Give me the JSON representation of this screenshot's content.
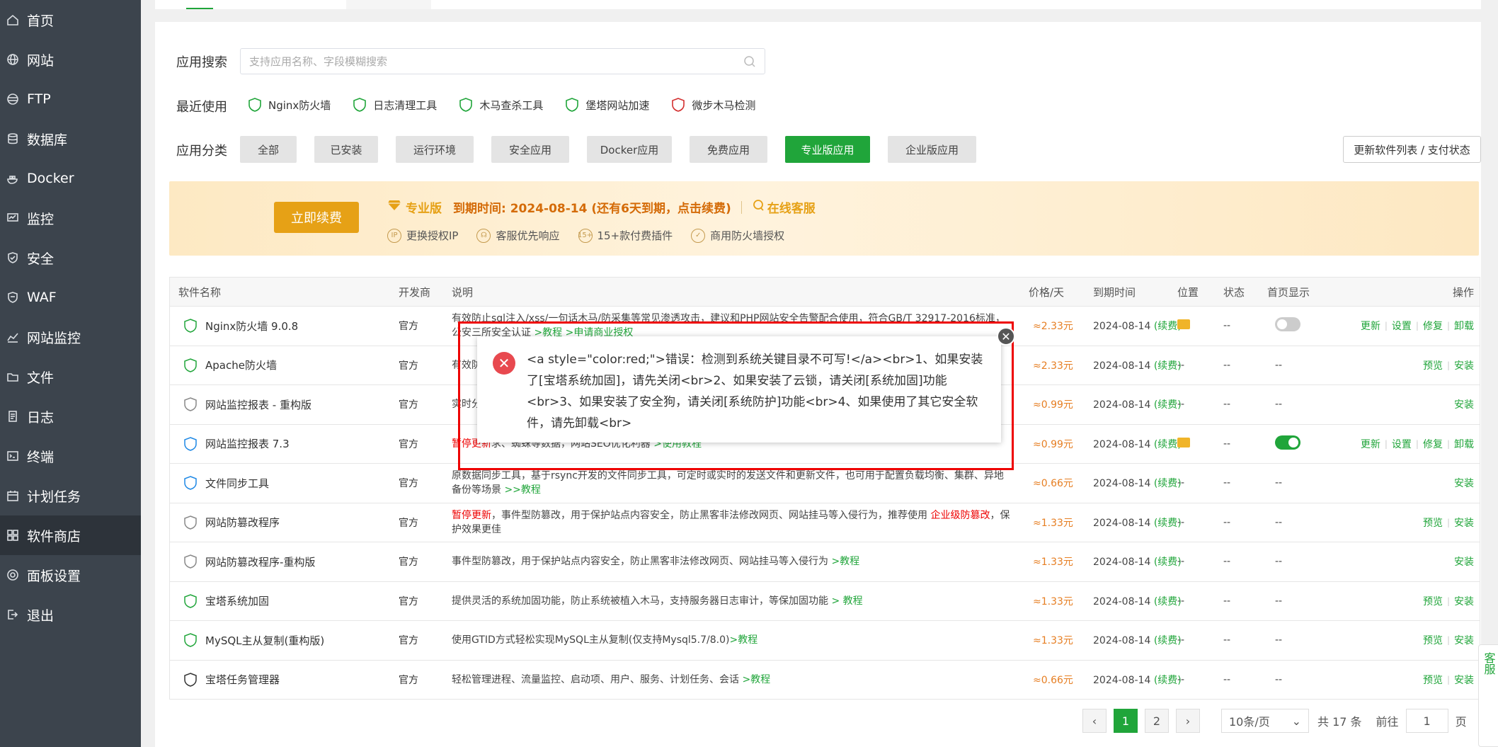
{
  "sidebar": {
    "items": [
      {
        "label": "首页",
        "icon": "home-icon"
      },
      {
        "label": "网站",
        "icon": "globe-icon"
      },
      {
        "label": "FTP",
        "icon": "ftp-icon"
      },
      {
        "label": "数据库",
        "icon": "database-icon"
      },
      {
        "label": "Docker",
        "icon": "docker-icon"
      },
      {
        "label": "监控",
        "icon": "monitor-icon"
      },
      {
        "label": "安全",
        "icon": "shield-icon"
      },
      {
        "label": "WAF",
        "icon": "waf-icon"
      },
      {
        "label": "网站监控",
        "icon": "chart-icon"
      },
      {
        "label": "文件",
        "icon": "folder-icon"
      },
      {
        "label": "日志",
        "icon": "log-icon"
      },
      {
        "label": "终端",
        "icon": "terminal-icon"
      },
      {
        "label": "计划任务",
        "icon": "calendar-icon"
      },
      {
        "label": "软件商店",
        "icon": "grid-icon"
      },
      {
        "label": "面板设置",
        "icon": "gear-icon"
      },
      {
        "label": "退出",
        "icon": "logout-icon"
      }
    ],
    "active_index": 13
  },
  "search": {
    "label": "应用搜索",
    "placeholder": "支持应用名称、字段模糊搜索"
  },
  "recent": {
    "label": "最近使用",
    "items": [
      "Nginx防火墙",
      "日志清理工具",
      "木马查杀工具",
      "堡塔网站加速",
      "微步木马检测"
    ]
  },
  "categories": {
    "label": "应用分类",
    "items": [
      "全部",
      "已安装",
      "运行环境",
      "安全应用",
      "Docker应用",
      "免费应用",
      "专业版应用",
      "企业版应用"
    ],
    "active": "专业版应用",
    "refresh": "更新软件列表 / 支付状态"
  },
  "banner": {
    "renew": "立即续费",
    "edition": "专业版",
    "expire": "到期时间: 2024-08-14 (还有6天到期，点击续费)",
    "service": "在线客服",
    "perks": [
      "更换授权IP",
      "客服优先响应",
      "15+款付费插件",
      "商用防火墙授权"
    ],
    "perk_badges": [
      "IP",
      "☊",
      "15+",
      "✓"
    ]
  },
  "table": {
    "headers": {
      "name": "软件名称",
      "dev": "开发商",
      "desc": "说明",
      "price": "价格/天",
      "expire": "到期时间",
      "pos": "位置",
      "state": "状态",
      "home": "首页显示",
      "ops": "操作"
    },
    "rows": [
      {
        "name": "Nginx防火墙 9.0.8",
        "dev": "官方",
        "desc_pre": "有效防止sql注入/xss/一句话木马/防采集等常见渗透攻击，建议和PHP网站安全告警配合使用，符合GB/T 32917-2016标准，公安三所安全认证",
        "desc_red": "",
        "desc_link": " >教程  >申请商业授权",
        "price": "≈2.33元",
        "expire": "2024-08-14",
        "renew": "(续费)",
        "pos": "folder",
        "state": "--",
        "home": "off",
        "ops": [
          "更新",
          "设置",
          "修复",
          "卸载"
        ]
      },
      {
        "name": "Apache防火墙",
        "dev": "官方",
        "desc_pre": "有效防",
        "desc_red": "",
        "desc_link": "",
        "price": "≈2.33元",
        "expire": "2024-08-14",
        "renew": "(续费)",
        "pos": "--",
        "state": "--",
        "home": "--",
        "ops": [
          "预览",
          "安装"
        ]
      },
      {
        "name": "网站监控报表 - 重构版",
        "dev": "官方",
        "desc_pre": "实时分析网站运行状态，s当前",
        "desc_red": "",
        "desc_link": "",
        "price": "≈0.99元",
        "expire": "2024-08-14",
        "renew": "(续费)",
        "pos": "--",
        "state": "--",
        "home": "--",
        "ops": [
          "安装"
        ]
      },
      {
        "name": "网站监控报表 7.3",
        "dev": "官方",
        "desc_pre": "",
        "desc_red": "暂停更新",
        "desc_mid": "求、蜘蛛等数据，网站SEO优化利器",
        "desc_link": " >使用教程",
        "price": "≈0.99元",
        "expire": "2024-08-14",
        "renew": "(续费)",
        "pos": "folder",
        "state": "--",
        "home": "on",
        "ops": [
          "更新",
          "设置",
          "修复",
          "卸载"
        ]
      },
      {
        "name": "文件同步工具",
        "dev": "官方",
        "desc_pre": "原数据同步工具，基于rsync开发的文件同步工具，可定时或实时的发送文件和更新文件，也可用于配置负载均衡、集群、异地备份等场景",
        "desc_red": "",
        "desc_link": " >>教程",
        "price": "≈0.66元",
        "expire": "2024-08-14",
        "renew": "(续费)",
        "pos": "--",
        "state": "--",
        "home": "--",
        "ops": [
          "安装"
        ]
      },
      {
        "name": "网站防篡改程序",
        "dev": "官方",
        "desc_pre": "",
        "desc_red": "暂停更新",
        "desc_mid": "，事件型防篡改，用于保护站点内容安全，防止黑客非法修改网页、网站挂马等入侵行为，推荐使用 ",
        "desc_red2": "企业级防篡改",
        "desc_tail": "，保护效果更佳",
        "desc_link": "",
        "price": "≈1.33元",
        "expire": "2024-08-14",
        "renew": "(续费)",
        "pos": "--",
        "state": "--",
        "home": "--",
        "ops": [
          "预览",
          "安装"
        ]
      },
      {
        "name": "网站防篡改程序-重构版",
        "dev": "官方",
        "desc_pre": "事件型防篡改，用于保护站点内容安全，防止黑客非法修改网页、网站挂马等入侵行为",
        "desc_red": "",
        "desc_link": " >教程",
        "price": "≈1.33元",
        "expire": "2024-08-14",
        "renew": "(续费)",
        "pos": "--",
        "state": "--",
        "home": "--",
        "ops": [
          "安装"
        ]
      },
      {
        "name": "宝塔系统加固",
        "dev": "官方",
        "desc_pre": "提供灵活的系统加固功能，防止系统被植入木马，支持服务器日志审计，等保加固功能",
        "desc_red": "",
        "desc_link": " > 教程",
        "price": "≈1.33元",
        "expire": "2024-08-14",
        "renew": "(续费)",
        "pos": "--",
        "state": "--",
        "home": "--",
        "ops": [
          "预览",
          "安装"
        ]
      },
      {
        "name": "MySQL主从复制(重构版)",
        "dev": "官方",
        "desc_pre": "使用GTID方式轻松实现MySQL主从复制(仅支持Mysql5.7/8.0)",
        "desc_red": "",
        "desc_link": ">教程",
        "price": "≈1.33元",
        "expire": "2024-08-14",
        "renew": "(续费)",
        "pos": "--",
        "state": "--",
        "home": "--",
        "ops": [
          "预览",
          "安装"
        ]
      },
      {
        "name": "宝塔任务管理器",
        "dev": "官方",
        "desc_pre": "轻松管理进程、流量监控、启动项、用户、服务、计划任务、会话",
        "desc_red": "",
        "desc_link": " >教程",
        "price": "≈0.66元",
        "expire": "2024-08-14",
        "renew": "(续费)",
        "pos": "--",
        "state": "--",
        "home": "--",
        "ops": [
          "预览",
          "安装"
        ]
      }
    ]
  },
  "pager": {
    "prev": "‹",
    "pages": [
      "1",
      "2"
    ],
    "next": "›",
    "per_page": "10条/页",
    "total": "共 17 条",
    "goto": "前往",
    "goto_value": "1",
    "page_unit": "页"
  },
  "modal": {
    "message": "<a style=\"color:red;\">错误：检测到系统关键目录不可写!</a><br>1、如果安装了[宝塔系统加固]，请先关闭<br>2、如果安装了云锁，请关闭[系统加固]功能<br>3、如果安装了安全狗，请关闭[系统防护]功能<br>4、如果使用了其它安全软件，请先卸载<br>",
    "close": "✕",
    "error": "✕"
  },
  "float_service": "客服"
}
